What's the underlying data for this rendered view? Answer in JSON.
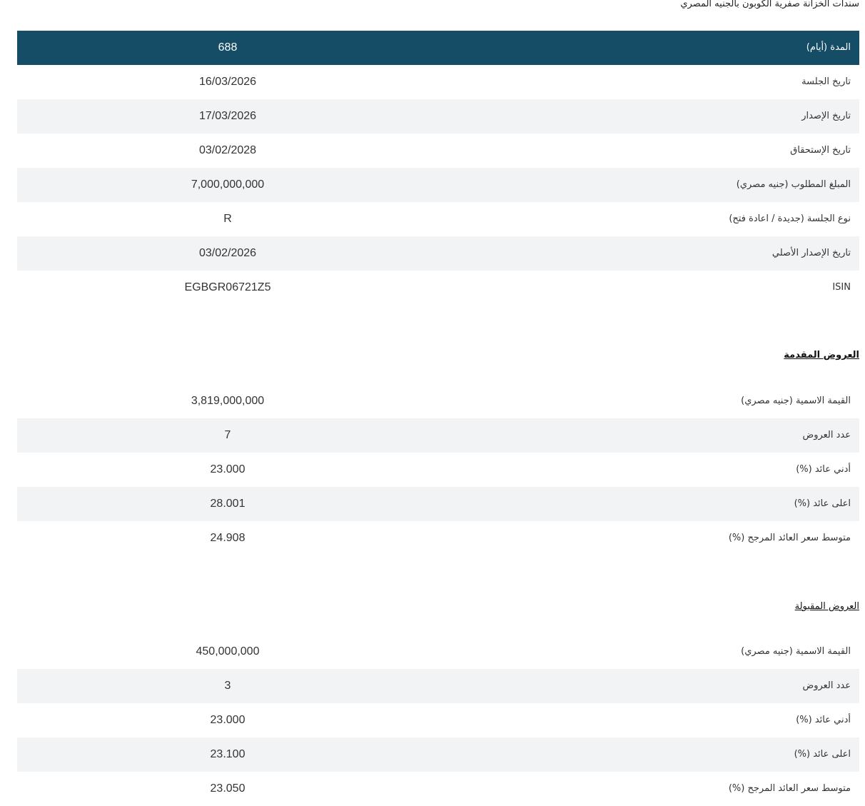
{
  "page_title": "سندات الخزانة صفرية الكوبون بالجنيه المصري",
  "details": {
    "rows": [
      {
        "label": "المدة (أيام)",
        "value": "688"
      },
      {
        "label": "تاريخ الجلسة",
        "value": "16/03/2026"
      },
      {
        "label": "تاريخ الإصدار",
        "value": "17/03/2026"
      },
      {
        "label": "تاريخ الإستحقاق",
        "value": "03/02/2028"
      },
      {
        "label": "المبلغ المطلوب (جنيه مصري)",
        "value": "7,000,000,000"
      },
      {
        "label": "نوع الجلسة (جديدة / اعادة فتح)",
        "value": "R"
      },
      {
        "label": "تاريخ الإصدار الأصلي",
        "value": "03/02/2026"
      },
      {
        "label": "ISIN",
        "value": "EGBGR06721Z5"
      }
    ]
  },
  "offers": {
    "title": "العروض المقدمة",
    "rows": [
      {
        "label": "القيمة الاسمية (جنيه مصري)",
        "value": "3,819,000,000"
      },
      {
        "label": "عدد العروض",
        "value": "7"
      },
      {
        "label": "أدني عائد (%)",
        "value": "23.000"
      },
      {
        "label": "اعلى عائد (%)",
        "value": "28.001"
      },
      {
        "label": "متوسط سعر العائد المرجح (%)",
        "value": "24.908"
      }
    ]
  },
  "accepted": {
    "title": "العروض المقبولة",
    "rows": [
      {
        "label": "القيمة الاسمية (جنيه مصري)",
        "value": "450,000,000"
      },
      {
        "label": "عدد العروض",
        "value": "3"
      },
      {
        "label": "أدني عائد (%)",
        "value": "23.000"
      },
      {
        "label": "اعلى عائد (%)",
        "value": "23.100"
      },
      {
        "label": "متوسط سعر العائد المرجح (%)",
        "value": "23.050"
      }
    ]
  },
  "colors": {
    "header_bg": "#154c66",
    "alt_row_bg": "#f2f3f5"
  }
}
